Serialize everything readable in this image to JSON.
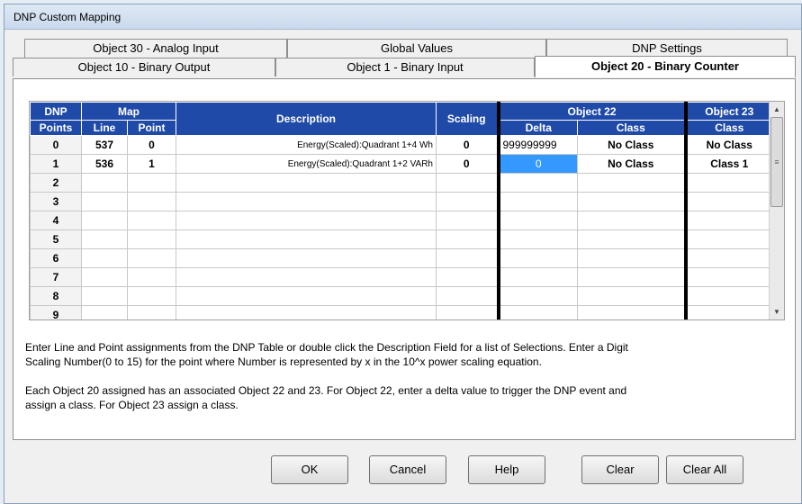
{
  "window": {
    "title": "DNP Custom Mapping"
  },
  "tabs": {
    "row1": [
      "Object 30 - Analog Input",
      "Global Values",
      "DNP Settings"
    ],
    "row2": [
      "Object 10 - Binary Output",
      "Object 1 - Binary Input",
      "Object 20 - Binary Counter"
    ],
    "active": "Object 20 - Binary Counter"
  },
  "grid": {
    "headers": {
      "dnp": "DNP",
      "points": "Points",
      "map": "Map",
      "line": "Line",
      "point": "Point",
      "description": "Description",
      "scaling": "Scaling",
      "object22": "Object 22",
      "delta": "Delta",
      "class22": "Class",
      "object23": "Object 23",
      "class23": "Class"
    },
    "rows": [
      {
        "dnp": "0",
        "line": "537",
        "point": "0",
        "description": "Energy(Scaled):Quadrant 1+4 Wh",
        "scaling": "0",
        "delta": "999999999",
        "class22": "No Class",
        "class23": "No Class"
      },
      {
        "dnp": "1",
        "line": "536",
        "point": "1",
        "description": "Energy(Scaled):Quadrant 1+2 VARh",
        "scaling": "0",
        "delta": "0",
        "class22": "No Class",
        "class23": "Class 1"
      },
      {
        "dnp": "2",
        "line": "",
        "point": "",
        "description": "",
        "scaling": "",
        "delta": "",
        "class22": "",
        "class23": ""
      },
      {
        "dnp": "3",
        "line": "",
        "point": "",
        "description": "",
        "scaling": "",
        "delta": "",
        "class22": "",
        "class23": ""
      },
      {
        "dnp": "4",
        "line": "",
        "point": "",
        "description": "",
        "scaling": "",
        "delta": "",
        "class22": "",
        "class23": ""
      },
      {
        "dnp": "5",
        "line": "",
        "point": "",
        "description": "",
        "scaling": "",
        "delta": "",
        "class22": "",
        "class23": ""
      },
      {
        "dnp": "6",
        "line": "",
        "point": "",
        "description": "",
        "scaling": "",
        "delta": "",
        "class22": "",
        "class23": ""
      },
      {
        "dnp": "7",
        "line": "",
        "point": "",
        "description": "",
        "scaling": "",
        "delta": "",
        "class22": "",
        "class23": ""
      },
      {
        "dnp": "8",
        "line": "",
        "point": "",
        "description": "",
        "scaling": "",
        "delta": "",
        "class22": "",
        "class23": ""
      },
      {
        "dnp": "9",
        "line": "",
        "point": "",
        "description": "",
        "scaling": "",
        "delta": "",
        "class22": "",
        "class23": ""
      }
    ],
    "selected_cell": {
      "row": 1,
      "column": "delta"
    }
  },
  "instructions": {
    "line1": "Enter Line and Point assignments from the DNP Table or double click the Description Field for a list of Selections.  Enter a Digit",
    "line2": "Scaling Number(0 to 15) for the point where Number is represented by x in the 10^x power scaling equation.",
    "line3": "Each Object 20 assigned has an associated Object 22 and 23.  For Object 22, enter a delta value to trigger the DNP event and",
    "line4": "assign a class.  For Object 23 assign a class."
  },
  "buttons": {
    "ok": "OK",
    "cancel": "Cancel",
    "help": "Help",
    "clear": "Clear",
    "clear_all": "Clear All"
  },
  "colors": {
    "header_bg": "#1f4aa8",
    "selection": "#3399ff"
  }
}
